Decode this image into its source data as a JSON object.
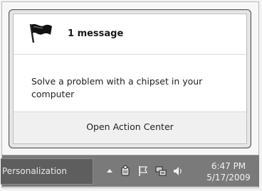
{
  "notification": {
    "message_count": "1 message",
    "body": "Solve a problem with a chipset in your computer",
    "footer_link": "Open Action Center"
  },
  "taskbar": {
    "active_task": "Personalization",
    "tray_icons": [
      "show-hidden-icons-arrow",
      "security-icon",
      "action-center-flag-icon",
      "network-icon",
      "volume-icon"
    ],
    "clock": {
      "time": "6:47 PM",
      "date": "5/17/2009"
    }
  }
}
